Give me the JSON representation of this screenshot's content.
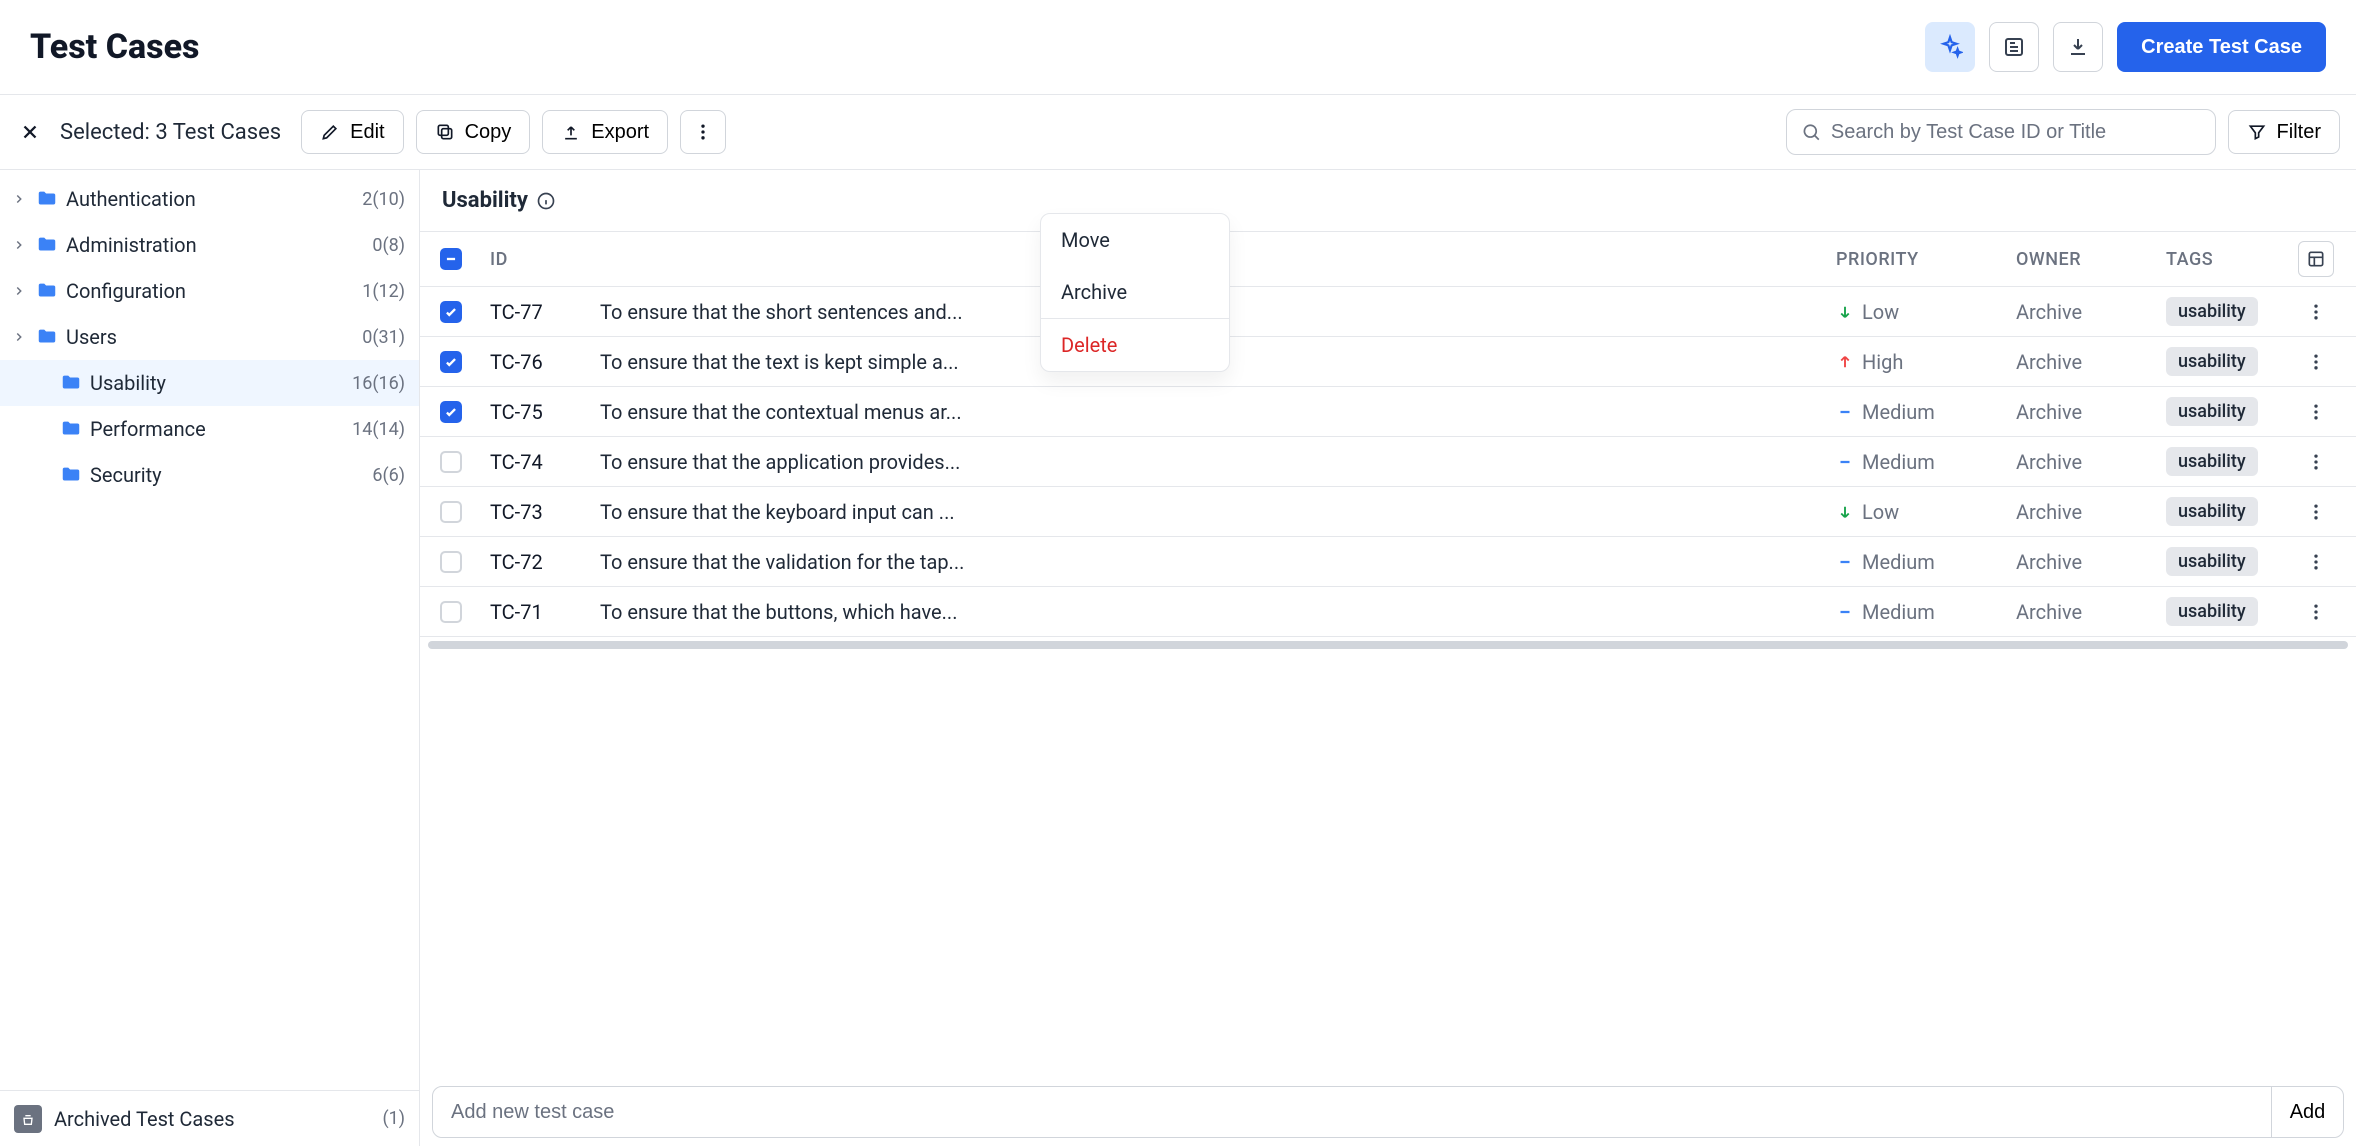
{
  "header": {
    "title": "Test Cases",
    "create_btn": "Create Test Case"
  },
  "toolbar": {
    "selected_label": "Selected: 3 Test Cases",
    "edit_label": "Edit",
    "copy_label": "Copy",
    "export_label": "Export",
    "filter_label": "Filter",
    "search_placeholder": "Search by Test Case ID or Title"
  },
  "dropdown": {
    "move": "Move",
    "archive": "Archive",
    "delete": "Delete"
  },
  "folders": [
    {
      "name": "Authentication",
      "count": "2(10)",
      "has_children": true,
      "active": false
    },
    {
      "name": "Administration",
      "count": "0(8)",
      "has_children": true,
      "active": false
    },
    {
      "name": "Configuration",
      "count": "1(12)",
      "has_children": true,
      "active": false
    },
    {
      "name": "Users",
      "count": "0(31)",
      "has_children": true,
      "active": false
    },
    {
      "name": "Usability",
      "count": "16(16)",
      "has_children": false,
      "active": true
    },
    {
      "name": "Performance",
      "count": "14(14)",
      "has_children": false,
      "active": false
    },
    {
      "name": "Security",
      "count": "6(6)",
      "has_children": false,
      "active": false
    }
  ],
  "archived": {
    "label": "Archived Test Cases",
    "count": "(1)"
  },
  "main": {
    "folder_title": "Usability",
    "columns": {
      "id": "ID",
      "priority": "PRIORITY",
      "owner": "OWNER",
      "tags": "TAGS"
    },
    "rows": [
      {
        "id": "TC-77",
        "title": "To ensure that the short sentences and...",
        "priority": "Low",
        "owner": "Archive",
        "tag": "usability",
        "checked": true
      },
      {
        "id": "TC-76",
        "title": "To ensure that the text is kept simple a...",
        "priority": "High",
        "owner": "Archive",
        "tag": "usability",
        "checked": true
      },
      {
        "id": "TC-75",
        "title": "To ensure that the contextual menus ar...",
        "priority": "Medium",
        "owner": "Archive",
        "tag": "usability",
        "checked": true
      },
      {
        "id": "TC-74",
        "title": "To ensure that the application provides...",
        "priority": "Medium",
        "owner": "Archive",
        "tag": "usability",
        "checked": false
      },
      {
        "id": "TC-73",
        "title": "To ensure that the keyboard input can ...",
        "priority": "Low",
        "owner": "Archive",
        "tag": "usability",
        "checked": false
      },
      {
        "id": "TC-72",
        "title": "To ensure that the validation for the tap...",
        "priority": "Medium",
        "owner": "Archive",
        "tag": "usability",
        "checked": false
      },
      {
        "id": "TC-71",
        "title": "To ensure that the buttons, which have...",
        "priority": "Medium",
        "owner": "Archive",
        "tag": "usability",
        "checked": false
      }
    ],
    "add_placeholder": "Add new test case",
    "add_btn": "Add"
  },
  "priority_colors": {
    "Low": "#16a34a",
    "High": "#ef4444",
    "Medium": "#3b82f6"
  }
}
